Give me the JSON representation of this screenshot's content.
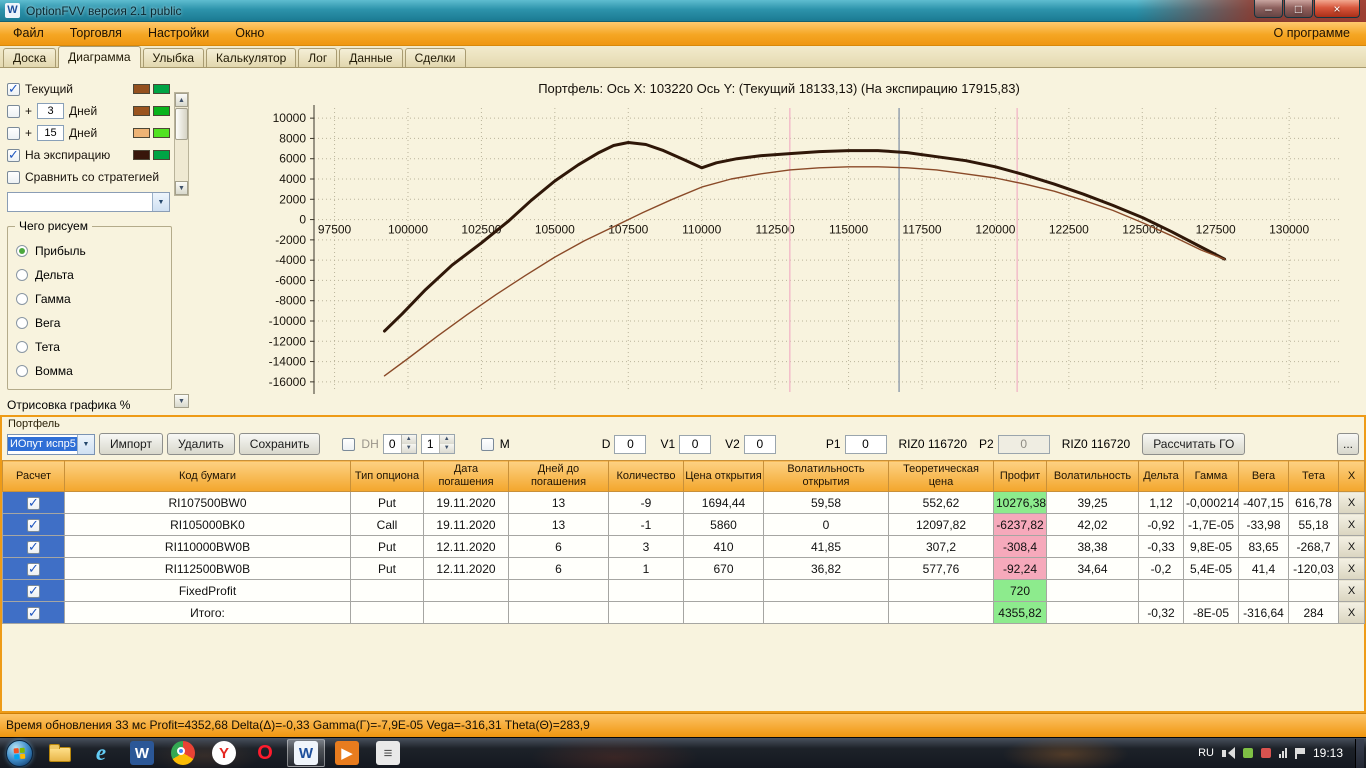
{
  "window": {
    "title": "OptionFVV версия 2.1 public",
    "icon_glyph": "W"
  },
  "menubar": {
    "items": [
      "Файл",
      "Торговля",
      "Настройки",
      "Окно"
    ],
    "right_item": "О программе"
  },
  "tabs": {
    "items": [
      "Доска",
      "Диаграмма",
      "Улыбка",
      "Калькулятор",
      "Лог",
      "Данные",
      "Сделки"
    ],
    "active": "Диаграмма"
  },
  "sidebar": {
    "current": {
      "label": "Текущий",
      "checked": true,
      "swatches": [
        "#94501e",
        "#00a445"
      ]
    },
    "plus3": {
      "prefix": "+",
      "value": "3",
      "label": "Дней",
      "checked": false,
      "swatches": [
        "#9a541f",
        "#09b31c"
      ]
    },
    "plus15": {
      "prefix": "+",
      "value": "15",
      "label": "Дней",
      "checked": false,
      "swatches": [
        "#edb375",
        "#52e222"
      ]
    },
    "expiration": {
      "label": "На экспирацию",
      "checked": true,
      "swatches": [
        "#38160a",
        "#00a445"
      ]
    },
    "compare": {
      "label": "Сравнить со стратегией",
      "checked": false
    },
    "strategy_combo_value": "",
    "draw_group": {
      "title": "Чего рисуем",
      "options": [
        "Прибыль",
        "Дельта",
        "Гамма",
        "Вега",
        "Тета",
        "Вомма"
      ],
      "selected": "Прибыль"
    },
    "bottom_label": "Отрисовка графика %"
  },
  "chart_data": {
    "type": "line",
    "title": "Портфель:  Ось X: 103220  Ось Y:  (Текущий 18133,13)  (На экспирацию 17915,83)",
    "xlabel": "",
    "ylabel": "",
    "xlim": [
      96800,
      131800
    ],
    "ylim": [
      -17000,
      11000
    ],
    "grid": "dotted",
    "legend_position": "none",
    "x_ticks": [
      97500,
      100000,
      102500,
      105000,
      107500,
      110000,
      112500,
      115000,
      117500,
      120000,
      122500,
      125000,
      127500,
      130000
    ],
    "y_ticks": [
      10000,
      8000,
      6000,
      4000,
      2000,
      0,
      -2000,
      -4000,
      -6000,
      -8000,
      -10000,
      -12000,
      -14000,
      -16000
    ],
    "markers": [
      {
        "x": 113000,
        "color": "#f2b9c8"
      },
      {
        "x": 116720,
        "color": "#8d9aab"
      },
      {
        "x": 120740,
        "color": "#f2b9c8"
      }
    ],
    "series": [
      {
        "name": "На экспирацию",
        "color": "#2f1708",
        "width": 3,
        "points": [
          [
            99200,
            -11000
          ],
          [
            99800,
            -9300
          ],
          [
            100600,
            -6900
          ],
          [
            101500,
            -4500
          ],
          [
            102500,
            -2300
          ],
          [
            103400,
            -200
          ],
          [
            104200,
            1900
          ],
          [
            105000,
            3800
          ],
          [
            105800,
            5400
          ],
          [
            106500,
            6600
          ],
          [
            107000,
            7300
          ],
          [
            107500,
            7600
          ],
          [
            108100,
            7400
          ],
          [
            108700,
            6800
          ],
          [
            109400,
            5900
          ],
          [
            110000,
            5100
          ],
          [
            110500,
            5600
          ],
          [
            111200,
            6000
          ],
          [
            112000,
            6300
          ],
          [
            113000,
            6500
          ],
          [
            114000,
            6700
          ],
          [
            115000,
            6800
          ],
          [
            116000,
            6800
          ],
          [
            117000,
            6600
          ],
          [
            118000,
            6200
          ],
          [
            119000,
            5800
          ],
          [
            120000,
            5200
          ],
          [
            121000,
            4400
          ],
          [
            122000,
            3500
          ],
          [
            123000,
            2500
          ],
          [
            124000,
            1400
          ],
          [
            125000,
            200
          ],
          [
            126000,
            -1200
          ],
          [
            127000,
            -2700
          ],
          [
            127800,
            -3900
          ]
        ]
      },
      {
        "name": "Текущий",
        "color": "#8a4a28",
        "width": 1.4,
        "points": [
          [
            99200,
            -15400
          ],
          [
            100000,
            -13700
          ],
          [
            101000,
            -11500
          ],
          [
            102000,
            -9400
          ],
          [
            103000,
            -7400
          ],
          [
            104000,
            -5500
          ],
          [
            105000,
            -3700
          ],
          [
            106000,
            -2100
          ],
          [
            107000,
            -700
          ],
          [
            108000,
            700
          ],
          [
            109000,
            2000
          ],
          [
            110000,
            3200
          ],
          [
            111000,
            4000
          ],
          [
            112000,
            4500
          ],
          [
            113000,
            4900
          ],
          [
            114000,
            5100
          ],
          [
            115000,
            5200
          ],
          [
            116000,
            5200
          ],
          [
            117000,
            5100
          ],
          [
            118000,
            4900
          ],
          [
            119000,
            4500
          ],
          [
            120000,
            4100
          ],
          [
            121000,
            3500
          ],
          [
            122000,
            2800
          ],
          [
            123000,
            1900
          ],
          [
            124000,
            900
          ],
          [
            125000,
            -300
          ],
          [
            126000,
            -1600
          ],
          [
            127000,
            -3000
          ],
          [
            127800,
            -3900
          ]
        ]
      }
    ]
  },
  "portfolio": {
    "group_label": "Портфель",
    "toolbar": {
      "preset_value": "ИОпут испр5",
      "import_label": "Импорт",
      "delete_label": "Удалить",
      "save_label": "Сохранить",
      "dh_label": "DH",
      "dh_checked": false,
      "spin1": "0",
      "spin2": "1",
      "m_label": "M",
      "m_checked": false,
      "d_label": "D",
      "d_value": "0",
      "v1_label": "V1",
      "v1_value": "0",
      "v2_label": "V2",
      "v2_value": "0",
      "p1_label": "P1",
      "p1_value": "0",
      "riz_label_1": "RIZ0 116720",
      "p2_label": "P2",
      "p2_value": "0",
      "riz_label_2": "RIZ0 116720",
      "calc_label": "Рассчитать ГО",
      "more_label": "..."
    },
    "table": {
      "columns": [
        "Расчет",
        "Код бумаги",
        "Тип опциона",
        "Дата погашения",
        "Дней до погашения",
        "Количество",
        "Цена открытия",
        "Волатильность открытия",
        "Теоретическая цена",
        "Профит",
        "Волатильность",
        "Дельта",
        "Гамма",
        "Вега",
        "Тета",
        "X"
      ],
      "delete_label": "X",
      "rows": [
        {
          "checked": true,
          "profit": "pos",
          "cells": [
            "RI107500BW0",
            "Put",
            "19.11.2020",
            "13",
            "-9",
            "1694,44",
            "59,58",
            "552,62",
            "10276,38",
            "39,25",
            "1,12",
            "-0,000214",
            "-407,15",
            "616,78"
          ]
        },
        {
          "checked": true,
          "profit": "neg",
          "cells": [
            "RI105000BK0",
            "Call",
            "19.11.2020",
            "13",
            "-1",
            "5860",
            "0",
            "12097,82",
            "-6237,82",
            "42,02",
            "-0,92",
            "-1,7E-05",
            "-33,98",
            "55,18"
          ]
        },
        {
          "checked": true,
          "profit": "neg",
          "cells": [
            "RI110000BW0B",
            "Put",
            "12.11.2020",
            "6",
            "3",
            "410",
            "41,85",
            "307,2",
            "-308,4",
            "38,38",
            "-0,33",
            "9,8E-05",
            "83,65",
            "-268,7"
          ]
        },
        {
          "checked": true,
          "profit": "neg",
          "cells": [
            "RI112500BW0B",
            "Put",
            "12.11.2020",
            "6",
            "1",
            "670",
            "36,82",
            "577,76",
            "-92,24",
            "34,64",
            "-0,2",
            "5,4E-05",
            "41,4",
            "-120,03"
          ]
        },
        {
          "checked": true,
          "profit": "pos",
          "cells": [
            "FixedProfit",
            "",
            "",
            "",
            "",
            "",
            "",
            "",
            "720",
            "",
            "",
            "",
            "",
            ""
          ]
        },
        {
          "checked": true,
          "profit": "pos",
          "cells": [
            "Итого:",
            "",
            "",
            "",
            "",
            "",
            "",
            "",
            "4355,82",
            "",
            "-0,32",
            "-8E-05",
            "-316,64",
            "284"
          ]
        }
      ]
    }
  },
  "statusbar": {
    "text": "Время обновления 33 мс   Profit=4352,68 Delta(Δ)=-0,33 Gamma(Γ)=-7,9E-05 Vega=-316,31 Theta(Θ)=283,9"
  },
  "taskbar": {
    "buttons": [
      {
        "name": "taskbar-explorer-icon",
        "kind": "folder"
      },
      {
        "name": "taskbar-ie-icon",
        "kind": "ie",
        "glyph": "e"
      },
      {
        "name": "taskbar-office-icon",
        "kind": "sq",
        "glyph": "W",
        "bg": "#2b5797",
        "color": "#ffffff"
      },
      {
        "name": "taskbar-chrome-icon",
        "kind": "chrome"
      },
      {
        "name": "taskbar-yandex-icon",
        "kind": "circle",
        "glyph": "Y",
        "bg": "#ffffff",
        "color": "#e52620"
      },
      {
        "name": "taskbar-opera-icon",
        "kind": "ring",
        "glyph": "O",
        "color": "#ff1b2d"
      },
      {
        "name": "taskbar-optionfvv-icon",
        "kind": "sq",
        "glyph": "W",
        "bg": "#f0f5fb",
        "color": "#1d4f9c",
        "active": true
      },
      {
        "name": "taskbar-media-icon",
        "kind": "sq",
        "glyph": "▶",
        "bg": "#e87c1e",
        "color": "#ffffff"
      },
      {
        "name": "taskbar-notes-icon",
        "kind": "sq",
        "glyph": "≡",
        "bg": "#e9e9e9",
        "color": "#555555"
      }
    ],
    "tray": {
      "lang": "RU",
      "time": "19:13"
    }
  },
  "colors": {
    "accent_orange": "#f09819",
    "profit_green": "#8deb8d",
    "loss_pink": "#f6a9bb",
    "titlebar_teal": "#2d93ab",
    "checkbox_column_blue": "#3f6fc6"
  }
}
